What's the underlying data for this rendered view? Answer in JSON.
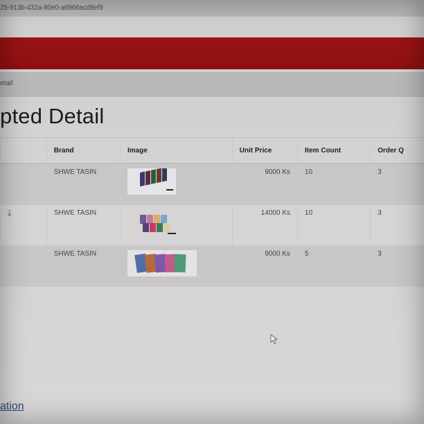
{
  "browser": {
    "url_fragment": "25-913b-432a-80e0-a6966acd8ef9"
  },
  "breadcrumb": {
    "current": "etail"
  },
  "page": {
    "title": "pted Detail"
  },
  "table": {
    "columns": [
      "",
      "Brand",
      "Image",
      "Unit Price",
      "Item Count",
      "Order Q"
    ],
    "rows": [
      {
        "first": "",
        "brand": "SHWE TASIN",
        "unit_price": "9000 Ks",
        "item_count": "10",
        "order_qty": "3"
      },
      {
        "first": "စ်",
        "brand": "SHWE TASIN",
        "unit_price": "14000 Ks",
        "item_count": "10",
        "order_qty": "3"
      },
      {
        "first": "",
        "brand": "SHWE TASIN",
        "unit_price": "9000 Ks",
        "item_count": "5",
        "order_qty": "3"
      }
    ]
  },
  "footer": {
    "link": "ation"
  },
  "colors": {
    "header_bar": "#8e1010",
    "page_bg": "#d4d2d2",
    "breadcrumb_bg": "#b8b7ba"
  }
}
